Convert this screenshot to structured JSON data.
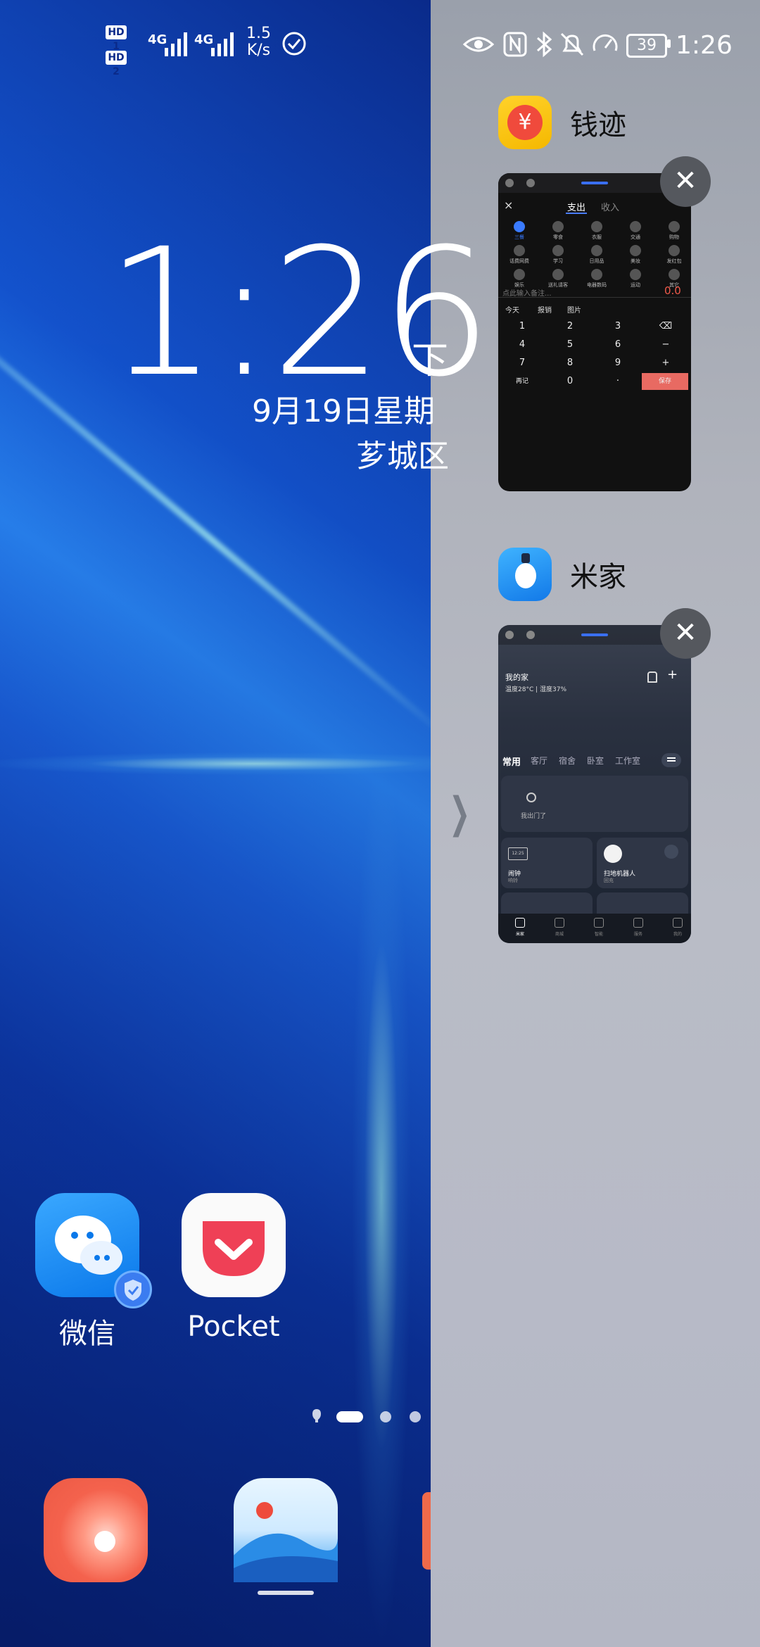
{
  "status_left": {
    "sim1": "HD 1",
    "sim2": "HD 2",
    "net1": "4G",
    "net2": "4G",
    "speed_value": "1.5",
    "speed_unit": "K/s"
  },
  "status_right": {
    "battery": "39",
    "time": "1:26"
  },
  "lockscreen": {
    "time": "1:26",
    "time_suffix": "下",
    "date": "9月19日星期",
    "location": "芗城区"
  },
  "home_apps": [
    {
      "label": "微信"
    },
    {
      "label": "Pocket"
    }
  ],
  "page_indicator": {
    "pages": 4,
    "current": 1
  },
  "recents": [
    {
      "app_name": "钱迹",
      "icon_color": "#f5c400",
      "icon_glyph": "¥",
      "screen": {
        "close_glyph": "×",
        "tabs": [
          "支出",
          "收入"
        ],
        "categories": [
          "三餐",
          "零食",
          "衣服",
          "交通",
          "购物",
          "话费网费",
          "学习",
          "日用品",
          "美妆",
          "发红包",
          "娱乐",
          "送礼请客",
          "电器数码",
          "运动",
          "其它"
        ],
        "note_placeholder": "点此输入备注...",
        "amount": "0.0",
        "quick": [
          "今天",
          "报销",
          "图片"
        ],
        "keypad": [
          "1",
          "2",
          "3",
          "⌫",
          "4",
          "5",
          "6",
          "−",
          "7",
          "8",
          "9",
          "+",
          "再记",
          "0",
          "·",
          "保存"
        ]
      }
    },
    {
      "app_name": "米家",
      "icon_color": "#1e90ff",
      "screen": {
        "home_title": "我的家",
        "weather": "温度28°C | 湿度37%",
        "tabs": [
          "常用",
          "客厅",
          "宿舍",
          "卧室",
          "工作室"
        ],
        "scene_text": "我出门了",
        "clock_display": "12:25",
        "devices": [
          {
            "name": "闹钟",
            "status": "响铃"
          },
          {
            "name": "扫地机器人",
            "status": "回充"
          }
        ],
        "bottom_nav": [
          "米家",
          "商城",
          "智能",
          "服务",
          "我的"
        ]
      }
    }
  ],
  "close_glyph": "✕",
  "expand_glyph": "❯"
}
